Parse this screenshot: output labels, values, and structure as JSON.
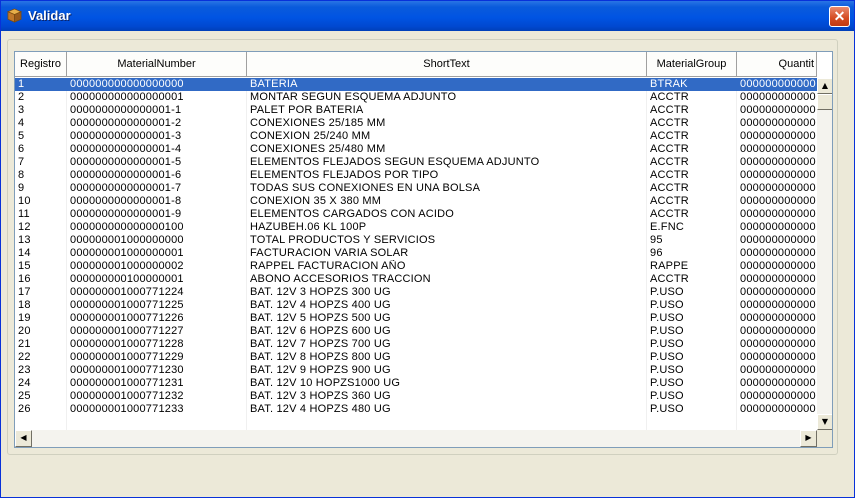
{
  "window": {
    "title": "Validar",
    "close_glyph": "✕"
  },
  "grid": {
    "columns": [
      "Registro",
      "MaterialNumber",
      "ShortText",
      "MaterialGroup",
      "Quantit"
    ],
    "rows": [
      [
        "1",
        "000000000000000000",
        "BATERIA",
        "BTRAK",
        "000000000000"
      ],
      [
        "2",
        "000000000000000001",
        "MONTAR SEGUN ESQUEMA ADJUNTO",
        "ACCTR",
        "000000000000"
      ],
      [
        "3",
        "0000000000000001-1",
        "PALET POR BATERIA",
        "ACCTR",
        "000000000000"
      ],
      [
        "4",
        "0000000000000001-2",
        "CONEXIONES 25/185 MM",
        "ACCTR",
        "000000000000"
      ],
      [
        "5",
        "0000000000000001-3",
        "CONEXION 25/240 MM",
        "ACCTR",
        "000000000000"
      ],
      [
        "6",
        "0000000000000001-4",
        "CONEXIONES 25/480 MM",
        "ACCTR",
        "000000000000"
      ],
      [
        "7",
        "0000000000000001-5",
        "ELEMENTOS FLEJADOS SEGUN ESQUEMA ADJUNTO",
        "ACCTR",
        "000000000000"
      ],
      [
        "8",
        "0000000000000001-6",
        "ELEMENTOS FLEJADOS POR TIPO",
        "ACCTR",
        "000000000000"
      ],
      [
        "9",
        "0000000000000001-7",
        "TODAS SUS CONEXIONES EN UNA BOLSA",
        "ACCTR",
        "000000000000"
      ],
      [
        "10",
        "0000000000000001-8",
        "CONEXION 35 X 380 MM",
        "ACCTR",
        "000000000000"
      ],
      [
        "11",
        "0000000000000001-9",
        "ELEMENTOS CARGADOS CON ACIDO",
        "ACCTR",
        "000000000000"
      ],
      [
        "12",
        "000000000000000100",
        "HAZUBEH.06 KL 100P",
        "E.FNC",
        "000000000000"
      ],
      [
        "13",
        "000000001000000000",
        "TOTAL PRODUCTOS Y SERVICIOS",
        "95",
        "000000000000"
      ],
      [
        "14",
        "000000001000000001",
        "FACTURACION VARIA SOLAR",
        "96",
        "000000000000"
      ],
      [
        "15",
        "000000001000000002",
        "RAPPEL FACTURACION AÑO",
        "RAPPE",
        "000000000000"
      ],
      [
        "16",
        "000000000100000001",
        "ABONO ACCESORIOS TRACCION",
        "ACCTR",
        "000000000000"
      ],
      [
        "17",
        "000000001000771224",
        "BAT. 12V 3 HOPZS 300 UG",
        "P.USO",
        "000000000000"
      ],
      [
        "18",
        "000000001000771225",
        "BAT. 12V 4 HOPZS 400 UG",
        "P.USO",
        "000000000000"
      ],
      [
        "19",
        "000000001000771226",
        "BAT. 12V 5 HOPZS 500 UG",
        "P.USO",
        "000000000000"
      ],
      [
        "20",
        "000000001000771227",
        "BAT. 12V 6 HOPZS 600 UG",
        "P.USO",
        "000000000000"
      ],
      [
        "21",
        "000000001000771228",
        "BAT. 12V 7 HOPZS 700 UG",
        "P.USO",
        "000000000000"
      ],
      [
        "22",
        "000000001000771229",
        "BAT. 12V 8 HOPZS 800 UG",
        "P.USO",
        "000000000000"
      ],
      [
        "23",
        "000000001000771230",
        "BAT. 12V 9 HOPZS 900 UG",
        "P.USO",
        "000000000000"
      ],
      [
        "24",
        "000000001000771231",
        "BAT. 12V 10 HOPZS1000 UG",
        "P.USO",
        "000000000000"
      ],
      [
        "25",
        "000000001000771232",
        "BAT. 12V 3 HOPZS 360 UG",
        "P.USO",
        "000000000000"
      ],
      [
        "26",
        "000000001000771233",
        "BAT. 12V 4 HOPZS 480 UG",
        "P.USO",
        "000000000000"
      ]
    ],
    "selected_row": 0
  },
  "colors": {
    "selection": "#316AC5",
    "titlebar": "#0054E3"
  },
  "icons": {
    "app": "package-icon",
    "close": "close-icon"
  }
}
